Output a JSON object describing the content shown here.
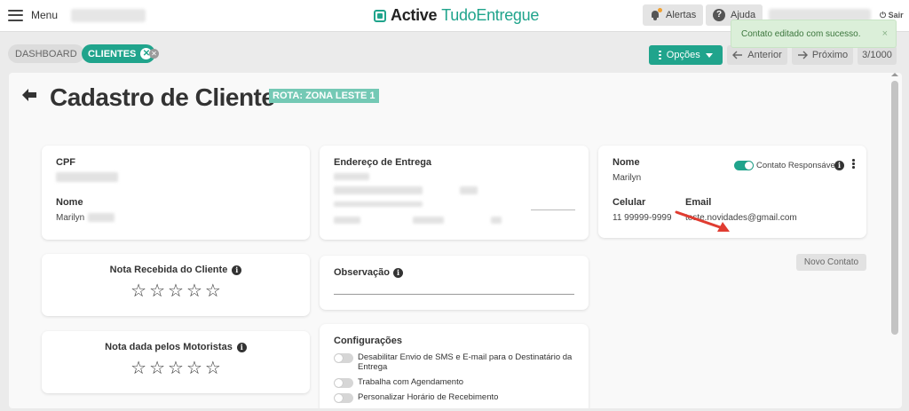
{
  "header": {
    "menu_label": "Menu",
    "brand_primary": "Active",
    "brand_secondary": "TudoEntregue",
    "alerts_label": "Alertas",
    "help_label": "Ajuda",
    "exit_label": "Sair"
  },
  "toast": {
    "message": "Contato editado com sucesso.",
    "close": "×"
  },
  "tabs": [
    {
      "label": "DASHBOARD"
    },
    {
      "label": "CLIENTES",
      "close": "✕"
    }
  ],
  "toolbar": {
    "options_label": "Opções",
    "prev_label": "Anterior",
    "next_label": "Próximo",
    "page_counter": "3/1000"
  },
  "page": {
    "title": "Cadastro de Cliente",
    "route_badge": "ROTA: ZONA LESTE 1"
  },
  "client_card": {
    "cpf_label": "CPF",
    "name_label": "Nome",
    "name_value": "Marilyn"
  },
  "address_card": {
    "label": "Endereço de Entrega"
  },
  "contact_card": {
    "name_label": "Nome",
    "name_value": "Marilyn",
    "responsible_label": "Contato Responsável",
    "responsible_on": true,
    "phone_label": "Celular",
    "phone_value": "11 99999-9999",
    "email_label": "Email",
    "email_value": "teste.novidades@gmail.com"
  },
  "new_contact_label": "Novo Contato",
  "rating_received": {
    "label": "Nota Recebida do Cliente",
    "rating": 0,
    "max": 5
  },
  "rating_given": {
    "label": "Nota dada pelos Motoristas",
    "rating": 0,
    "max": 5
  },
  "observation": {
    "label": "Observação"
  },
  "config": {
    "title": "Configurações",
    "items": [
      {
        "label": "Desabilitar Envio de SMS e E-mail para o Destinatário da Entrega",
        "on": false
      },
      {
        "label": "Trabalha com Agendamento",
        "on": false
      },
      {
        "label": "Personalizar Horário de Recebimento",
        "on": false
      }
    ]
  },
  "colors": {
    "accent": "#20a48c",
    "toast_bg": "#dbefd9",
    "annotation_arrow": "#e03c31"
  }
}
